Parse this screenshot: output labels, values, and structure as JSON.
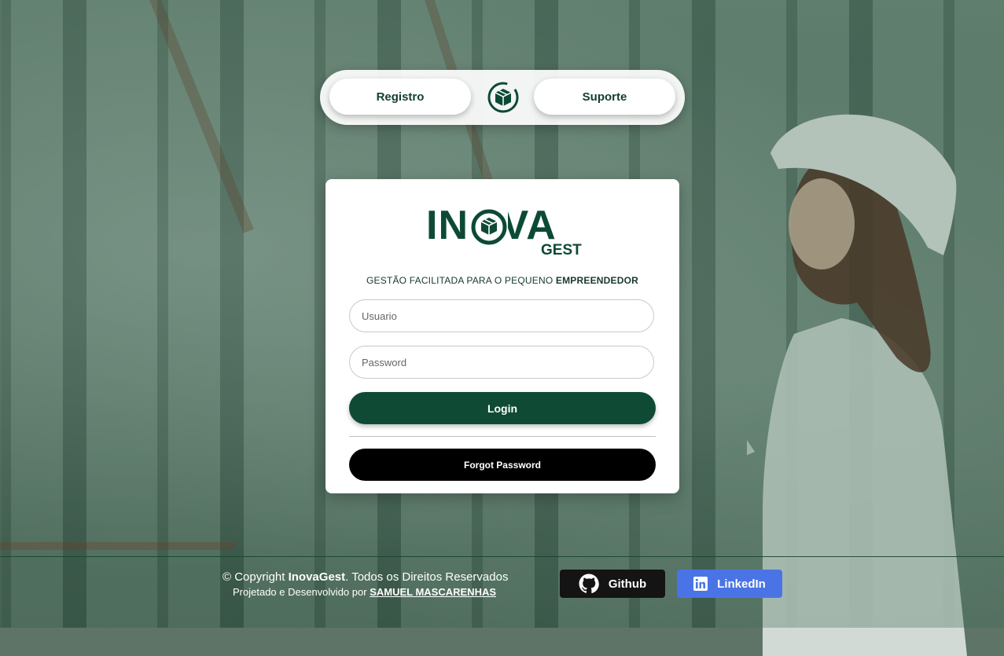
{
  "nav": {
    "register_label": "Registro",
    "support_label": "Suporte"
  },
  "brand": {
    "name_main": "INOVA",
    "name_sub": "GEST",
    "tagline_prefix": "GESTÃO FACILITADA PARA O PEQUENO",
    "tagline_bold": "EMPREENDEDOR",
    "primary_color": "#0d4a35"
  },
  "login": {
    "username_placeholder": "Usuario",
    "username_value": "",
    "password_placeholder": "Password",
    "password_value": "",
    "login_label": "Login",
    "forgot_label": "Forgot Password"
  },
  "footer": {
    "copyright_prefix": "© Copyright",
    "copyright_brand": "InovaGest",
    "copyright_suffix": ". Todos os Direitos Reservados",
    "credit_prefix": "Projetado e Desenvolvido por",
    "credit_author": "SAMUEL MASCARENHAS",
    "github_label": "Github",
    "github_icon": "github-icon",
    "linkedin_label": "LinkedIn",
    "linkedin_icon": "linkedin-icon",
    "linkedin_color": "#4a74e6"
  }
}
